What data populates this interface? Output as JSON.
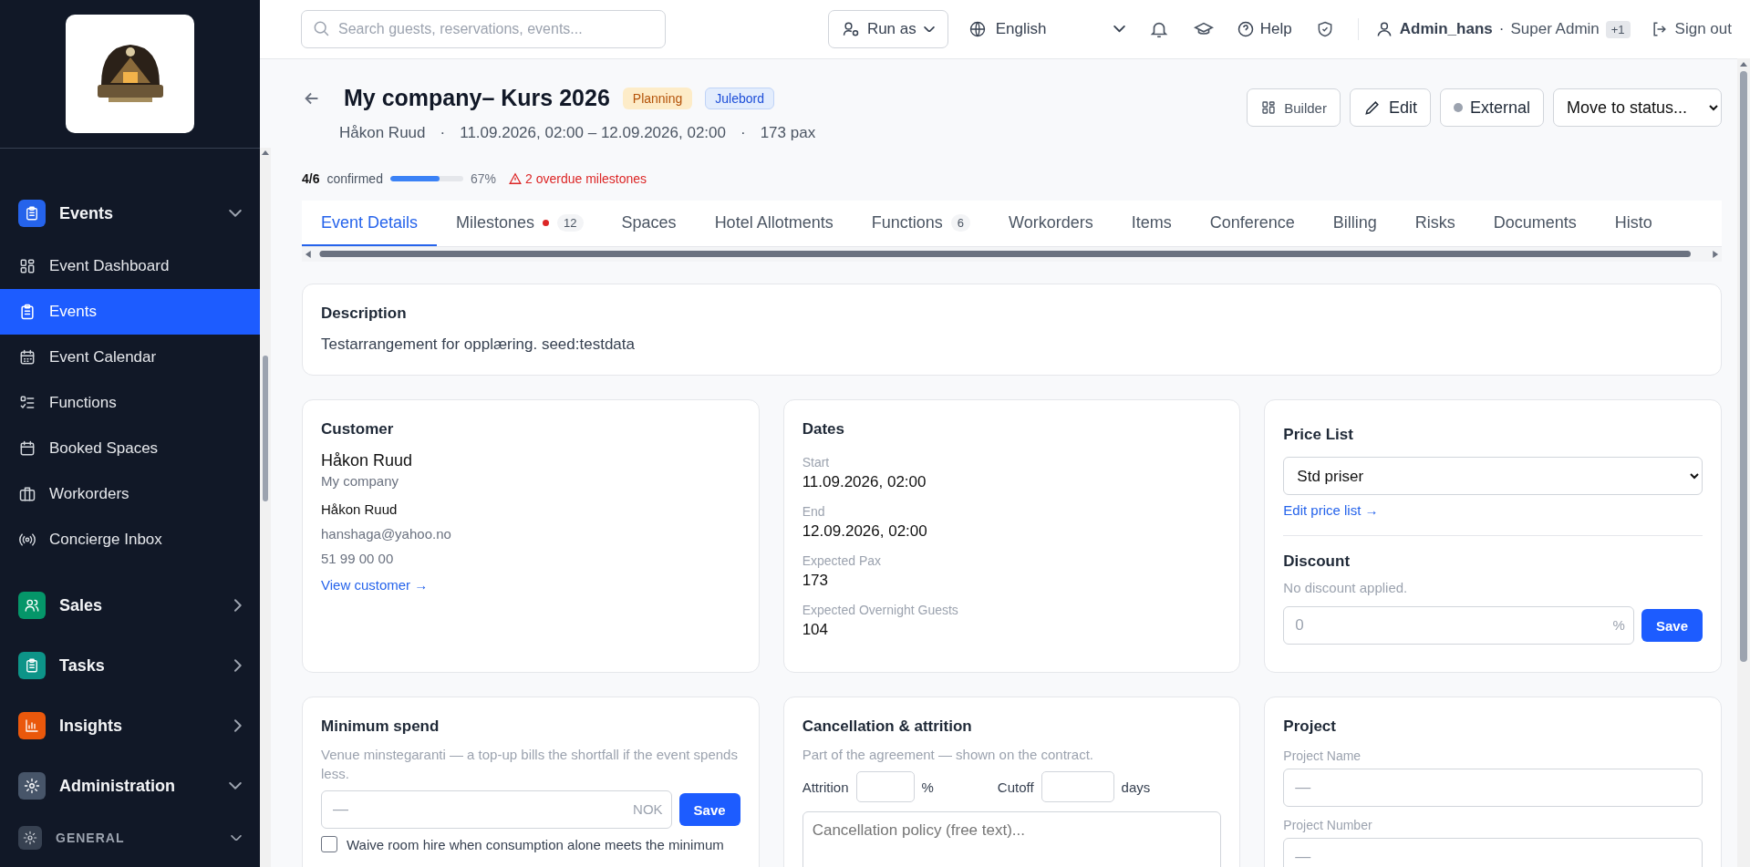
{
  "sidebar": {
    "sections": [
      {
        "label": "Events",
        "color": "#2563eb",
        "expanded": true,
        "children": [
          {
            "label": "Event Dashboard",
            "selected": false
          },
          {
            "label": "Events",
            "selected": true
          },
          {
            "label": "Event Calendar",
            "selected": false
          },
          {
            "label": "Functions",
            "selected": false
          },
          {
            "label": "Booked Spaces",
            "selected": false
          },
          {
            "label": "Workorders",
            "selected": false
          },
          {
            "label": "Concierge Inbox",
            "selected": false
          }
        ]
      },
      {
        "label": "Sales",
        "color": "#059669",
        "expanded": false
      },
      {
        "label": "Tasks",
        "color": "#0d9488",
        "expanded": false
      },
      {
        "label": "Insights",
        "color": "#ea580c",
        "expanded": false
      },
      {
        "label": "Administration",
        "color": "#475569",
        "expanded": true
      }
    ],
    "group": {
      "label": "GENERAL",
      "expanded": true
    }
  },
  "topbar": {
    "search": {
      "placeholder": "Search guests, reservations, events..."
    },
    "run_as": "Run as",
    "language": "English",
    "help": "Help",
    "user": "Admin_hans",
    "separator": "·",
    "role": "Super Admin",
    "extra_roles": "+1",
    "sign_out": "Sign out"
  },
  "header": {
    "title": "My company– Kurs 2026",
    "badges": [
      {
        "label": "Planning",
        "color": "#fdecc8"
      },
      {
        "label": "Julebord",
        "color": "#e3edfd"
      }
    ],
    "meta": [
      "Håkon Ruud",
      "11.09.2026, 02:00 – 12.09.2026, 02:00",
      "173 pax"
    ],
    "meta_separator": "·",
    "actions": {
      "builder": "Builder",
      "edit": "Edit",
      "external": "External",
      "status_select": "Move to status..."
    },
    "progress": {
      "count": "4/6",
      "label": "confirmed",
      "level": 0.67,
      "percent": "67%",
      "warning": "2 overdue milestones"
    }
  },
  "tabs": [
    {
      "label": "Event Details",
      "selected": true
    },
    {
      "label": "Milestones",
      "selected": false,
      "alert": true,
      "count": "12"
    },
    {
      "label": "Spaces",
      "selected": false
    },
    {
      "label": "Hotel Allotments",
      "selected": false
    },
    {
      "label": "Functions",
      "selected": false,
      "count": "6"
    },
    {
      "label": "Workorders",
      "selected": false
    },
    {
      "label": "Items",
      "selected": false
    },
    {
      "label": "Conference",
      "selected": false
    },
    {
      "label": "Billing",
      "selected": false
    },
    {
      "label": "Risks",
      "selected": false
    },
    {
      "label": "Documents",
      "selected": false
    },
    {
      "label": "Histo",
      "selected": false
    }
  ],
  "description": {
    "heading": "Description",
    "text": "Testarrangement for opplæring. seed:testdata"
  },
  "customer": {
    "heading": "Customer",
    "name": "Håkon Ruud",
    "company": "My company",
    "contact": "Håkon Ruud",
    "email": "hanshaga@yahoo.no",
    "phone": "51 99 00 00",
    "link": "View customer →"
  },
  "dates": {
    "heading": "Dates",
    "fields": [
      {
        "label": "Start",
        "value": "11.09.2026, 02:00"
      },
      {
        "label": "End",
        "value": "12.09.2026, 02:00"
      },
      {
        "label": "Expected Pax",
        "value": "173"
      },
      {
        "label": "Expected Overnight Guests",
        "value": "104"
      }
    ]
  },
  "pricing": {
    "heading": "Price List",
    "select": "Std priser",
    "link": "Edit price list →",
    "discount_heading": "Discount",
    "discount_note": "No discount applied.",
    "discount_value": "0",
    "unit": "%",
    "save": "Save"
  },
  "minimum_spend": {
    "heading": "Minimum spend",
    "note": "Venue minstegaranti — a top-up bills the shortfall if the event spends less.",
    "placeholder": "—",
    "unit": "NOK",
    "save": "Save",
    "waive": {
      "label": "Waive room hire when consumption alone meets the minimum",
      "checked": false
    }
  },
  "cancellation": {
    "heading": "Cancellation & attrition",
    "note": "Part of the agreement — shown on the contract.",
    "attrition_label": "Attrition",
    "attrition_unit": "%",
    "cutoff_label": "Cutoff",
    "cutoff_unit": "days",
    "policy_placeholder": "Cancellation policy (free text)..."
  },
  "project": {
    "heading": "Project",
    "fields": [
      {
        "label": "Project Name",
        "placeholder": "—"
      },
      {
        "label": "Project Number",
        "placeholder": "—"
      }
    ]
  }
}
